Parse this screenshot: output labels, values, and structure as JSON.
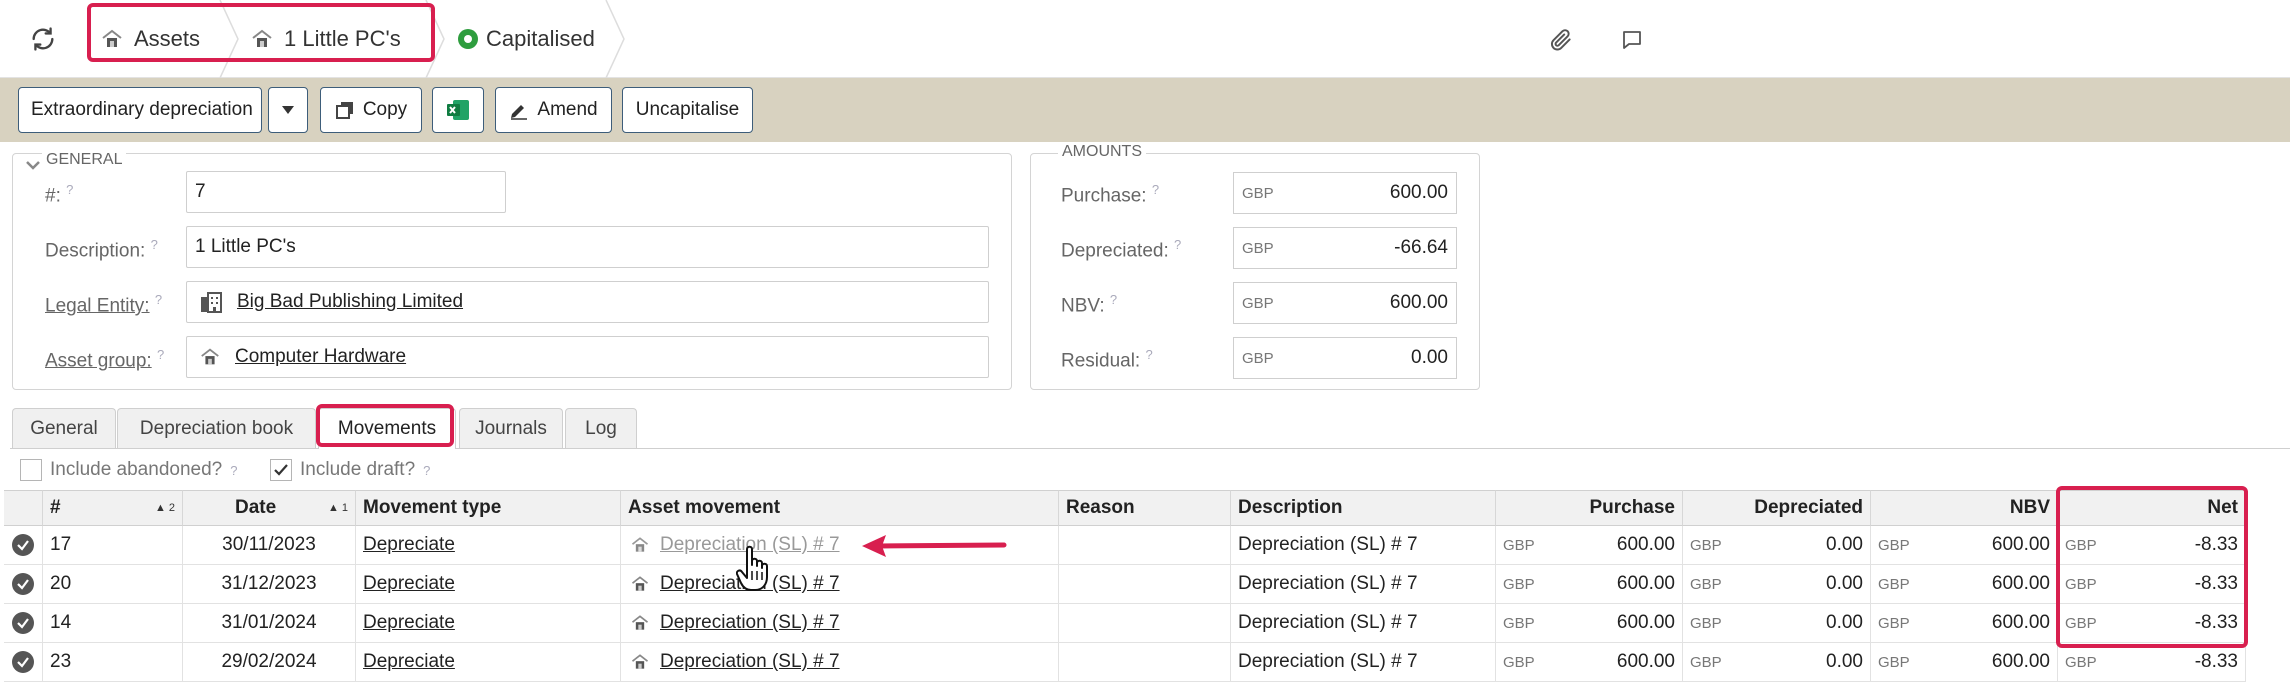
{
  "topbar": {
    "breadcrumbs": [
      {
        "label": "Assets",
        "icon": "asset-icon"
      },
      {
        "label": "1 Little PC's",
        "icon": "asset-icon"
      }
    ],
    "status": {
      "label": "Capitalised",
      "color": "#2e9d3e"
    },
    "icons": [
      "refresh-icon",
      "paperclip-icon",
      "comment-icon"
    ]
  },
  "toolbar": {
    "extraordinary_label": "Extraordinary depreciation",
    "copy_label": "Copy",
    "excel_icon": "excel-icon",
    "amend_label": "Amend",
    "uncapitalise_label": "Uncapitalise"
  },
  "general": {
    "title": "GENERAL",
    "number_label": "#:",
    "number_value": "7",
    "description_label": "Description:",
    "description_value": "1 Little PC's",
    "legal_entity_label": "Legal Entity:",
    "legal_entity_value": "Big Bad Publishing Limited",
    "asset_group_label": "Asset group:",
    "asset_group_value": "Computer Hardware",
    "help_mark": "?"
  },
  "amounts": {
    "title": "AMOUNTS",
    "rows": [
      {
        "label": "Purchase:",
        "currency": "GBP",
        "value": "600.00"
      },
      {
        "label": "Depreciated:",
        "currency": "GBP",
        "value": "-66.64"
      },
      {
        "label": "NBV:",
        "currency": "GBP",
        "value": "600.00"
      },
      {
        "label": "Residual:",
        "currency": "GBP",
        "value": "0.00"
      }
    ]
  },
  "tabs": [
    "General",
    "Depreciation book",
    "Movements",
    "Journals",
    "Log"
  ],
  "active_tab": "Movements",
  "filters": {
    "include_abandoned": {
      "label": "Include abandoned?",
      "checked": false
    },
    "include_draft": {
      "label": "Include draft?",
      "checked": true
    }
  },
  "grid": {
    "columns": {
      "number": "#",
      "number_sort": "▲ 2",
      "date": "Date",
      "date_sort": "▲ 1",
      "movement_type": "Movement type",
      "asset_movement": "Asset movement",
      "reason": "Reason",
      "description": "Description",
      "purchase": "Purchase",
      "depreciated": "Depreciated",
      "nbv": "NBV",
      "net": "Net"
    },
    "rows": [
      {
        "number": "17",
        "date": "30/11/2023",
        "movement_type": "Depreciate",
        "asset_movement": "Depreciation (SL) # 7",
        "reason": "",
        "description": "Depreciation (SL) # 7",
        "purchase_cur": "GBP",
        "purchase": "600.00",
        "depreciated_cur": "GBP",
        "depreciated": "0.00",
        "nbv_cur": "GBP",
        "nbv": "600.00",
        "net_cur": "GBP",
        "net": "-8.33"
      },
      {
        "number": "20",
        "date": "31/12/2023",
        "movement_type": "Depreciate",
        "asset_movement": "Depreciation (SL) # 7",
        "reason": "",
        "description": "Depreciation (SL) # 7",
        "purchase_cur": "GBP",
        "purchase": "600.00",
        "depreciated_cur": "GBP",
        "depreciated": "0.00",
        "nbv_cur": "GBP",
        "nbv": "600.00",
        "net_cur": "GBP",
        "net": "-8.33"
      },
      {
        "number": "14",
        "date": "31/01/2024",
        "movement_type": "Depreciate",
        "asset_movement": "Depreciation (SL) # 7",
        "reason": "",
        "description": "Depreciation (SL) # 7",
        "purchase_cur": "GBP",
        "purchase": "600.00",
        "depreciated_cur": "GBP",
        "depreciated": "0.00",
        "nbv_cur": "GBP",
        "nbv": "600.00",
        "net_cur": "GBP",
        "net": "-8.33"
      },
      {
        "number": "23",
        "date": "29/02/2024",
        "movement_type": "Depreciate",
        "asset_movement": "Depreciation (SL) # 7",
        "reason": "",
        "description": "Depreciation (SL) # 7",
        "purchase_cur": "GBP",
        "purchase": "600.00",
        "depreciated_cur": "GBP",
        "depreciated": "0.00",
        "nbv_cur": "GBP",
        "nbv": "600.00",
        "net_cur": "GBP",
        "net": "-8.33"
      }
    ]
  },
  "annotation": {
    "highlight_color": "#d81f4f",
    "arrow_color": "#d81f4f"
  }
}
